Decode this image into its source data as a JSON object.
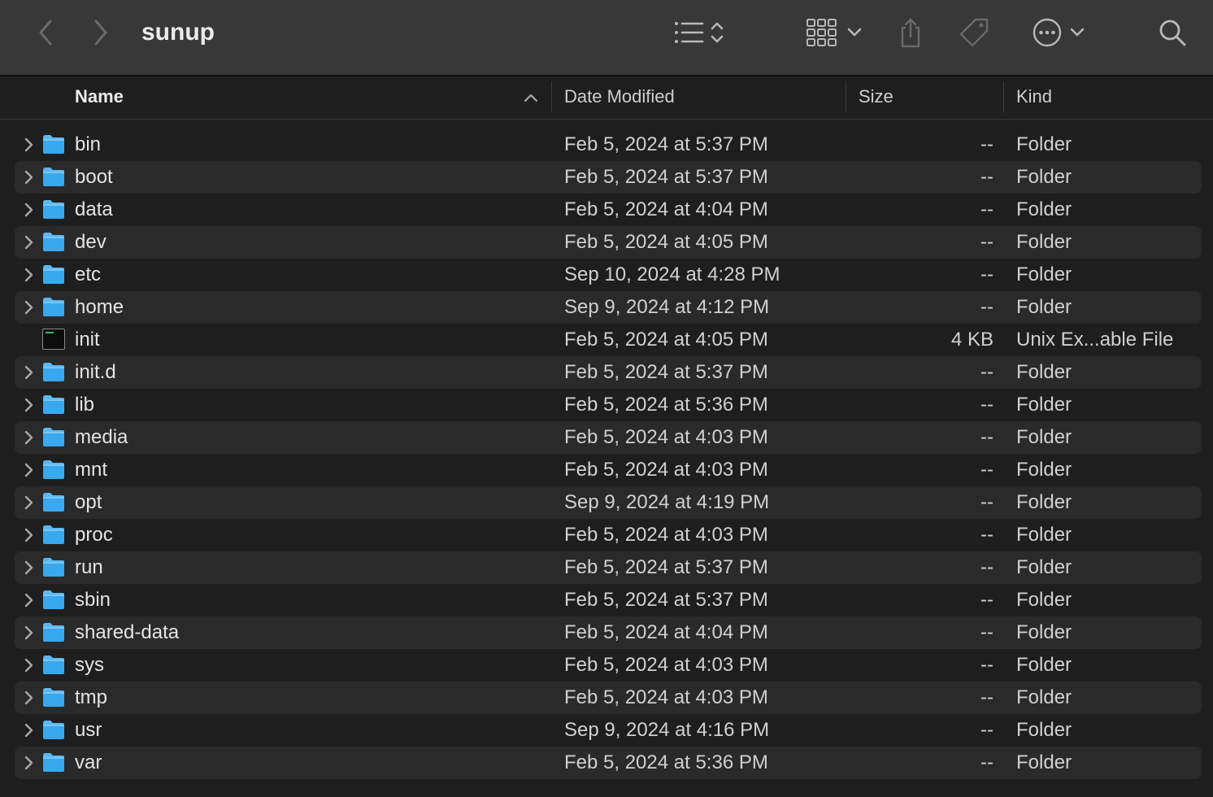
{
  "window": {
    "title": "sunup"
  },
  "toolbar": {
    "back_icon": "chevron-left",
    "forward_icon": "chevron-right",
    "list_view_icon": "list",
    "grid_view_icon": "grid",
    "share_icon": "share",
    "tag_icon": "tag",
    "more_icon": "ellipsis-circle",
    "search_icon": "magnifying-glass"
  },
  "columns": {
    "name": "Name",
    "date_modified": "Date Modified",
    "size": "Size",
    "kind": "Kind"
  },
  "rows": [
    {
      "name": "bin",
      "date": "Feb 5, 2024 at 5:37 PM",
      "size": "--",
      "kind": "Folder",
      "type": "folder"
    },
    {
      "name": "boot",
      "date": "Feb 5, 2024 at 5:37 PM",
      "size": "--",
      "kind": "Folder",
      "type": "folder"
    },
    {
      "name": "data",
      "date": "Feb 5, 2024 at 4:04 PM",
      "size": "--",
      "kind": "Folder",
      "type": "folder"
    },
    {
      "name": "dev",
      "date": "Feb 5, 2024 at 4:05 PM",
      "size": "--",
      "kind": "Folder",
      "type": "folder"
    },
    {
      "name": "etc",
      "date": "Sep 10, 2024 at 4:28 PM",
      "size": "--",
      "kind": "Folder",
      "type": "folder"
    },
    {
      "name": "home",
      "date": "Sep 9, 2024 at 4:12 PM",
      "size": "--",
      "kind": "Folder",
      "type": "folder"
    },
    {
      "name": "init",
      "date": "Feb 5, 2024 at 4:05 PM",
      "size": "4 KB",
      "kind": "Unix Ex...able File",
      "type": "exec"
    },
    {
      "name": "init.d",
      "date": "Feb 5, 2024 at 5:37 PM",
      "size": "--",
      "kind": "Folder",
      "type": "folder"
    },
    {
      "name": "lib",
      "date": "Feb 5, 2024 at 5:36 PM",
      "size": "--",
      "kind": "Folder",
      "type": "folder"
    },
    {
      "name": "media",
      "date": "Feb 5, 2024 at 4:03 PM",
      "size": "--",
      "kind": "Folder",
      "type": "folder"
    },
    {
      "name": "mnt",
      "date": "Feb 5, 2024 at 4:03 PM",
      "size": "--",
      "kind": "Folder",
      "type": "folder"
    },
    {
      "name": "opt",
      "date": "Sep 9, 2024 at 4:19 PM",
      "size": "--",
      "kind": "Folder",
      "type": "folder"
    },
    {
      "name": "proc",
      "date": "Feb 5, 2024 at 4:03 PM",
      "size": "--",
      "kind": "Folder",
      "type": "folder"
    },
    {
      "name": "run",
      "date": "Feb 5, 2024 at 5:37 PM",
      "size": "--",
      "kind": "Folder",
      "type": "folder"
    },
    {
      "name": "sbin",
      "date": "Feb 5, 2024 at 5:37 PM",
      "size": "--",
      "kind": "Folder",
      "type": "folder"
    },
    {
      "name": "shared-data",
      "date": "Feb 5, 2024 at 4:04 PM",
      "size": "--",
      "kind": "Folder",
      "type": "folder"
    },
    {
      "name": "sys",
      "date": "Feb 5, 2024 at 4:03 PM",
      "size": "--",
      "kind": "Folder",
      "type": "folder"
    },
    {
      "name": "tmp",
      "date": "Feb 5, 2024 at 4:03 PM",
      "size": "--",
      "kind": "Folder",
      "type": "folder"
    },
    {
      "name": "usr",
      "date": "Sep 9, 2024 at 4:16 PM",
      "size": "--",
      "kind": "Folder",
      "type": "folder"
    },
    {
      "name": "var",
      "date": "Feb 5, 2024 at 5:36 PM",
      "size": "--",
      "kind": "Folder",
      "type": "folder"
    }
  ],
  "colors": {
    "toolbar_bg": "#383838",
    "window_bg": "#1e1e1e",
    "row_alt_bg": "#2a2a2a",
    "folder_blue": "#3aa8ee",
    "text": "#e4e4e4",
    "icon_gray": "#a8a8a8"
  }
}
